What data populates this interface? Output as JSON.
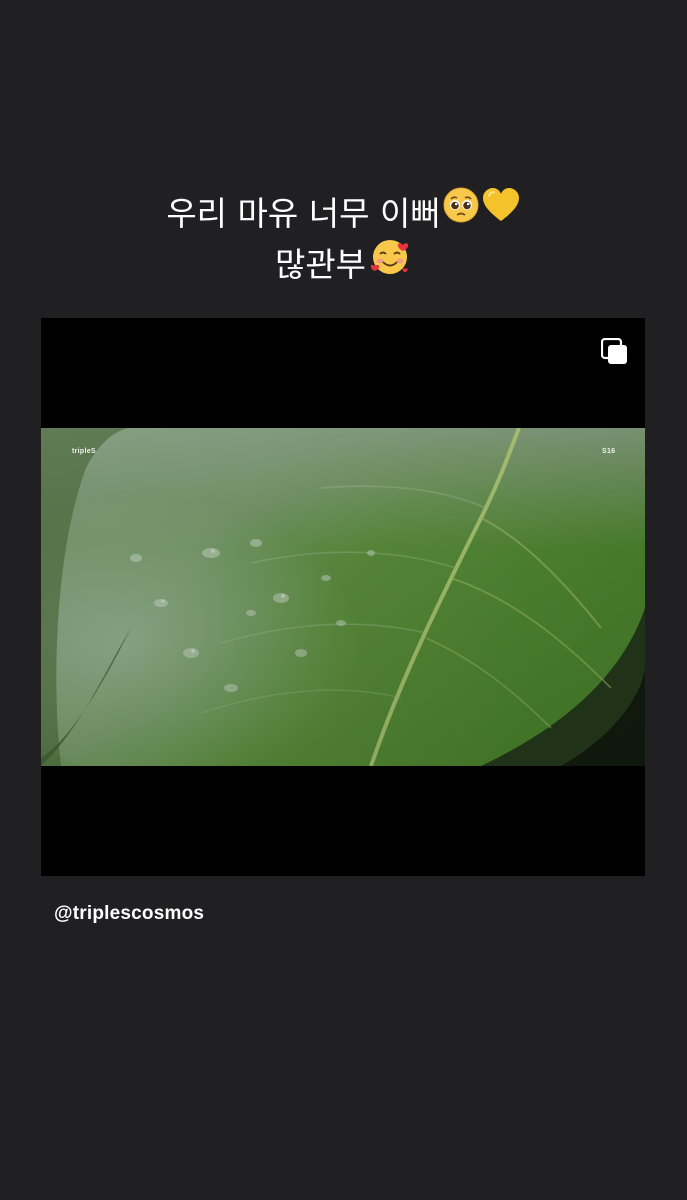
{
  "caption": {
    "line1": "우리 마유 너무 이뻐",
    "line2": "많관부"
  },
  "post": {
    "brand_left": "tripleS",
    "brand_right": "S16",
    "multi_icon": "carousel-copy-icon"
  },
  "mention": "@triplescosmos",
  "colors": {
    "background": "#202022",
    "post_background": "#000000",
    "leaf_green": "#5b8a43"
  }
}
